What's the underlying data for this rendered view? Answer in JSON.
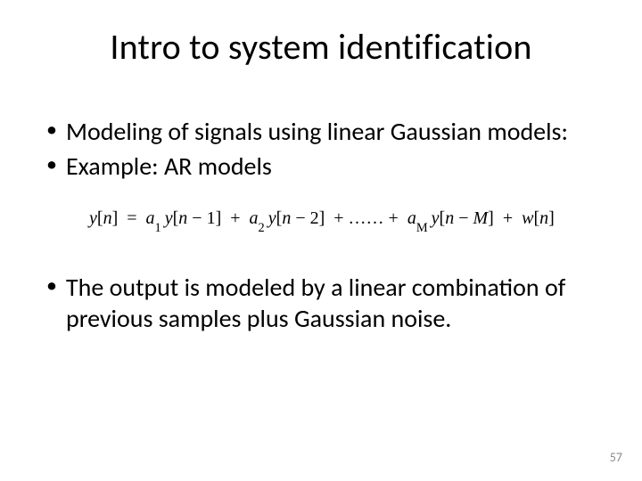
{
  "title": "Intro to system identification",
  "bullets_top": [
    "Modeling of signals using linear Gaussian models:",
    "Example: AR models"
  ],
  "equation": {
    "lhs_var": "y",
    "lhs_idx": "n",
    "terms": [
      {
        "coef_var": "a",
        "coef_sub": "1",
        "arg_left": "n",
        "arg_right": "1"
      },
      {
        "coef_var": "a",
        "coef_sub": "2",
        "arg_left": "n",
        "arg_right": "2"
      }
    ],
    "ellipsis": "……",
    "last_term": {
      "coef_var": "a",
      "coef_sub": "M",
      "arg_left": "n",
      "arg_right": "M"
    },
    "noise": {
      "var": "w",
      "idx": "n"
    }
  },
  "bullets_bottom": [
    "The output is modeled by a linear combination of previous samples plus Gaussian noise."
  ],
  "page_number": "57"
}
